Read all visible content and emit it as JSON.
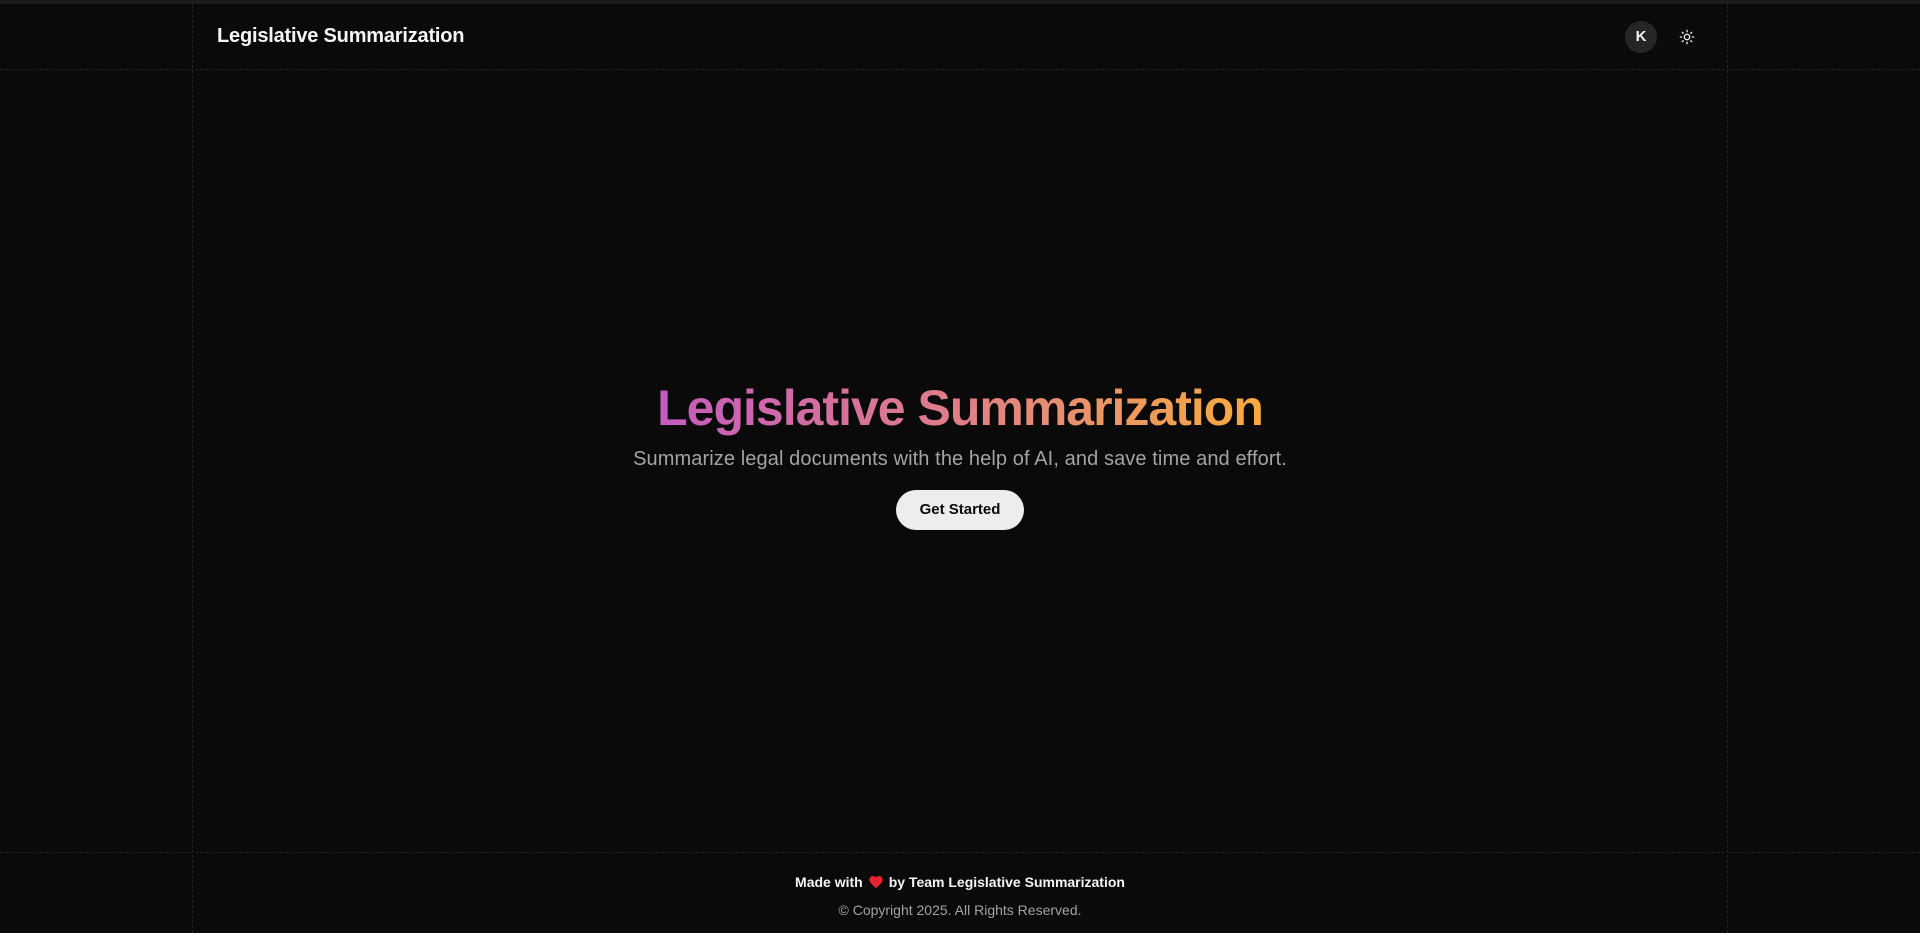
{
  "header": {
    "brand": "Legislative Summarization",
    "avatar_initial": "K",
    "theme_icon": "sun-icon"
  },
  "hero": {
    "title": "Legislative Summarization",
    "subtitle": "Summarize legal documents with the help of AI, and save time and effort.",
    "cta_label": "Get Started"
  },
  "footer": {
    "made_with": "Made with",
    "heart_icon": "heart-icon",
    "by_team": "by Team Legislative Summarization",
    "copyright": "© Copyright 2025. All Rights Reserved."
  },
  "colors": {
    "background": "#0a0a0a",
    "gradient_start": "#c45bbf",
    "gradient_mid": "#e07f86",
    "gradient_end": "#f7ac3e",
    "heart": "#e5222f",
    "button_bg": "#ededed"
  }
}
